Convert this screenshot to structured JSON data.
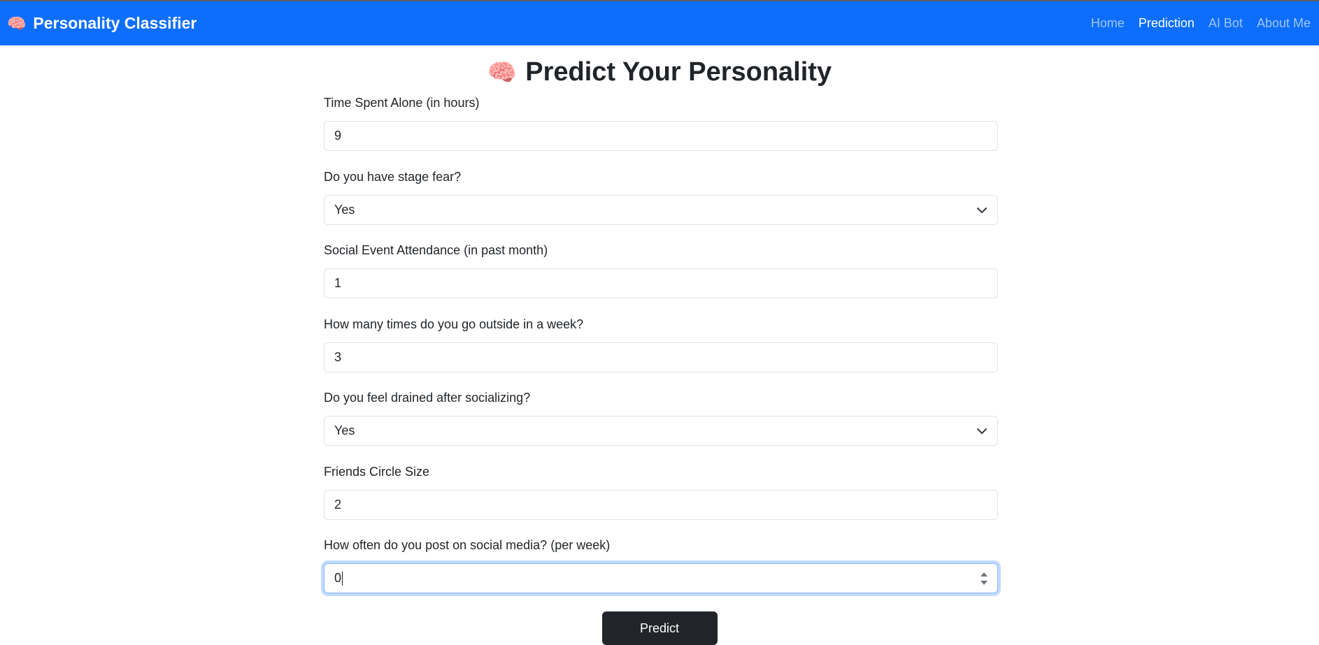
{
  "navbar": {
    "brand_icon": "🧠",
    "brand_label": "Personality Classifier",
    "links": [
      {
        "label": "Home",
        "active": false
      },
      {
        "label": "Prediction",
        "active": true
      },
      {
        "label": "AI Bot",
        "active": false
      },
      {
        "label": "About Me",
        "active": false
      }
    ],
    "background_color": "#0d6efd"
  },
  "page": {
    "title_icon": "🧠",
    "title": "Predict Your Personality"
  },
  "form": {
    "fields": [
      {
        "label": "Time Spent Alone (in hours)",
        "type": "number",
        "value": "9"
      },
      {
        "label": "Do you have stage fear?",
        "type": "select",
        "value": "Yes"
      },
      {
        "label": "Social Event Attendance (in past month)",
        "type": "number",
        "value": "1"
      },
      {
        "label": "How many times do you go outside in a week?",
        "type": "number",
        "value": "3"
      },
      {
        "label": "Do you feel drained after socializing?",
        "type": "select",
        "value": "Yes"
      },
      {
        "label": "Friends Circle Size",
        "type": "number",
        "value": "2"
      },
      {
        "label": "How often do you post on social media? (per week)",
        "type": "number",
        "value": "0",
        "focused": true
      }
    ],
    "submit_label": "Predict"
  }
}
